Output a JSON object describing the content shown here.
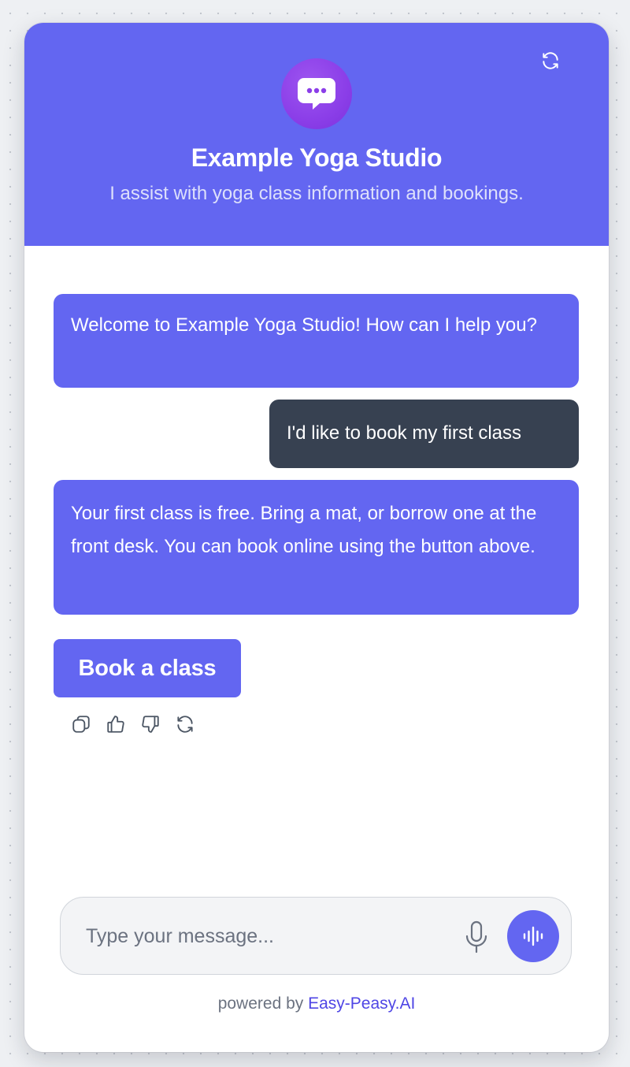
{
  "header": {
    "title": "Example Yoga Studio",
    "subtitle": "I assist with yoga class information and bookings.",
    "refresh_icon": "refresh-icon",
    "logo_icon": "chat-bubble-icon"
  },
  "messages": [
    {
      "role": "assistant",
      "text": "Welcome to Example Yoga Studio! How can I help you?"
    },
    {
      "role": "user",
      "text": "I'd like to book my first class"
    },
    {
      "role": "assistant",
      "text": "Your first class is free. Bring a mat, or borrow one at the front desk. You can book online using the button above."
    }
  ],
  "cta_button": {
    "label": "Book a class"
  },
  "message_actions": [
    "copy-icon",
    "thumbs-up-icon",
    "thumbs-down-icon",
    "regenerate-icon"
  ],
  "composer": {
    "placeholder": "Type your message...",
    "value": "",
    "mic_icon": "microphone-icon",
    "voice_icon": "voice-wave-icon"
  },
  "footer": {
    "prefix": "powered by",
    "link_text": "Easy-Peasy.AI"
  },
  "colors": {
    "brand": "#6366f1",
    "user_bubble": "#374151",
    "logo": "#8b3ee8",
    "link": "#4f46e5"
  }
}
